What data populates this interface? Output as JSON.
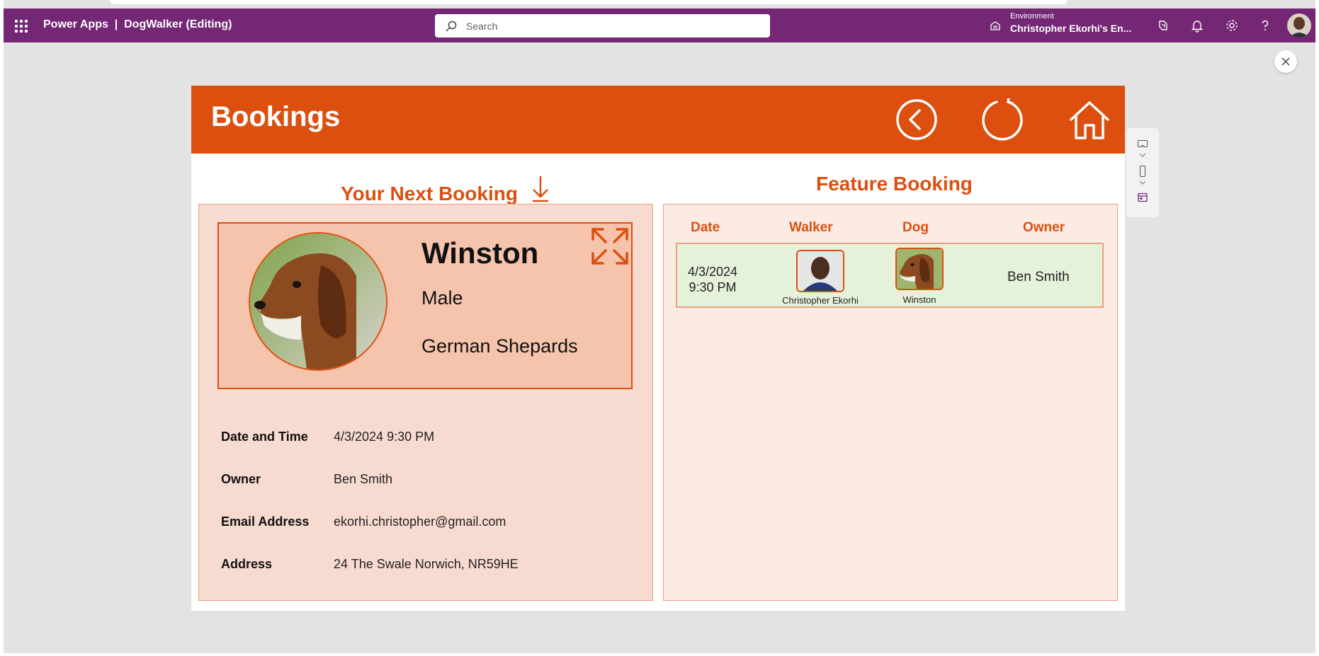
{
  "topbar": {
    "app_title": "Power Apps  |  DogWalker (Editing)",
    "search_placeholder": "Search",
    "environment_label": "Environment",
    "environment_name": "Christopher Ekorhi's En..."
  },
  "banner": {
    "title": "Bookings"
  },
  "next_booking": {
    "heading": "Your Next Booking",
    "dog": {
      "name": "Winston",
      "gender": "Male",
      "breed": "German Shepards"
    },
    "details": [
      {
        "label": "Date and Time",
        "value": "4/3/2024 9:30 PM"
      },
      {
        "label": "Owner",
        "value": "Ben Smith"
      },
      {
        "label": "Email Address",
        "value": "ekorhi.christopher@gmail.com"
      },
      {
        "label": "Address",
        "value": "24 The Swale Norwich, NR59HE"
      }
    ]
  },
  "feature_booking": {
    "heading": "Feature Booking",
    "columns": [
      "Date",
      "Walker",
      "Dog",
      "Owner"
    ],
    "rows": [
      {
        "date_line1": "4/3/2024",
        "date_line2": "9:30 PM",
        "walker": "Christopher Ekorhi",
        "dog": "Winston",
        "owner": "Ben Smith"
      }
    ]
  },
  "colors": {
    "header_purple": "#742774",
    "accent_orange": "#dc4f0f",
    "panel_left": "#f8dbd0",
    "panel_right": "#fbebe4",
    "row_green": "#e5f2d9"
  },
  "icons": [
    "app-launcher-icon",
    "search-icon",
    "environment-icon",
    "copilot-icon",
    "bell-icon",
    "gear-icon",
    "help-icon",
    "close-icon",
    "back-icon",
    "refresh-icon",
    "home-icon",
    "download-arrow-icon",
    "expand-icon"
  ]
}
